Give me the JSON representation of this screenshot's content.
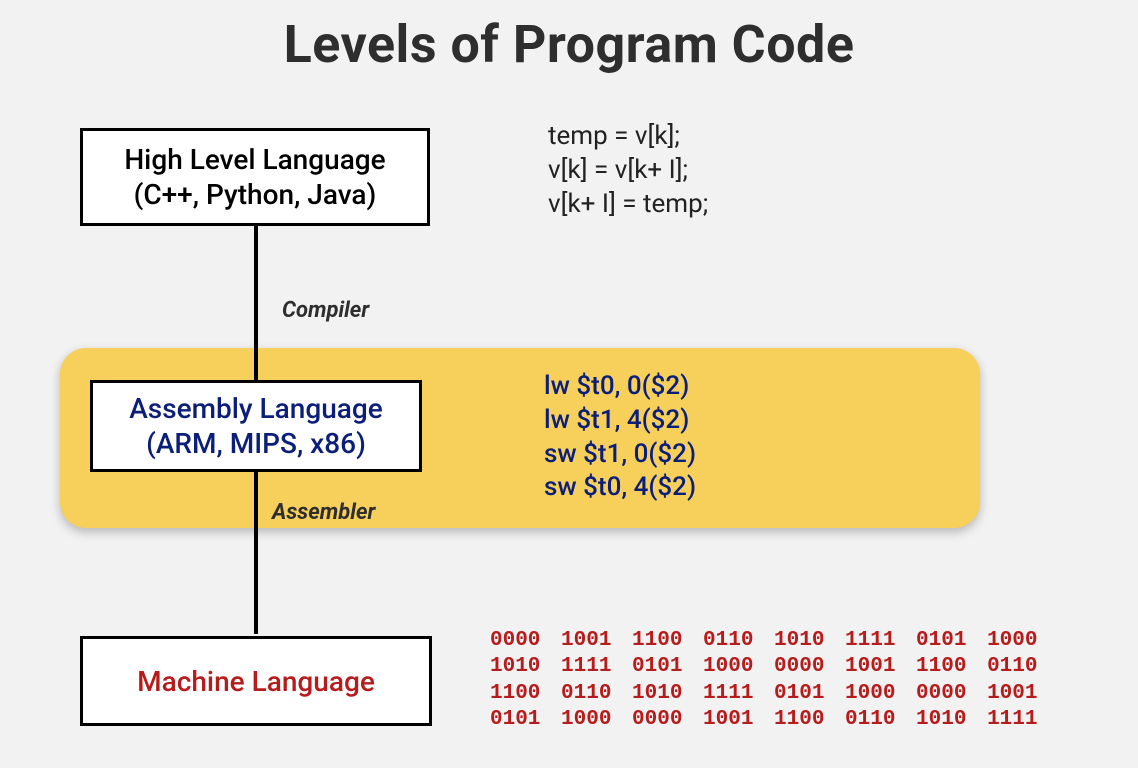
{
  "title": "Levels of Program Code",
  "levels": {
    "high": {
      "label_line1": "High Level Language",
      "label_line2": "(C++, Python, Java)",
      "code": "temp = v[k];\nv[k] = v[k+ I];\nv[k+ I] = temp;"
    },
    "assembly": {
      "label_line1": "Assembly Language",
      "label_line2": "(ARM, MIPS, x86)",
      "code": "lw $t0, 0($2)\nlw $t1, 4($2)\nsw $t1, 0($2)\nsw $t0, 4($2)"
    },
    "machine": {
      "label_line1": "Machine Language",
      "code": "0000 1001 1100 0110 1010 1111 0101 1000\n1010 1111 0101 1000 0000 1001 1100 0110\n1100 0110 1010 1111 0101 1000 0000 1001\n0101 1000 0000 1001 1100 0110 1010 1111"
    }
  },
  "transitions": {
    "compiler_label": "Compiler",
    "assembler_label": "Assembler"
  },
  "colors": {
    "accent_yellow": "#f6d05a",
    "assembly_blue": "#0b1e7a",
    "machine_red": "#b61c1c"
  }
}
